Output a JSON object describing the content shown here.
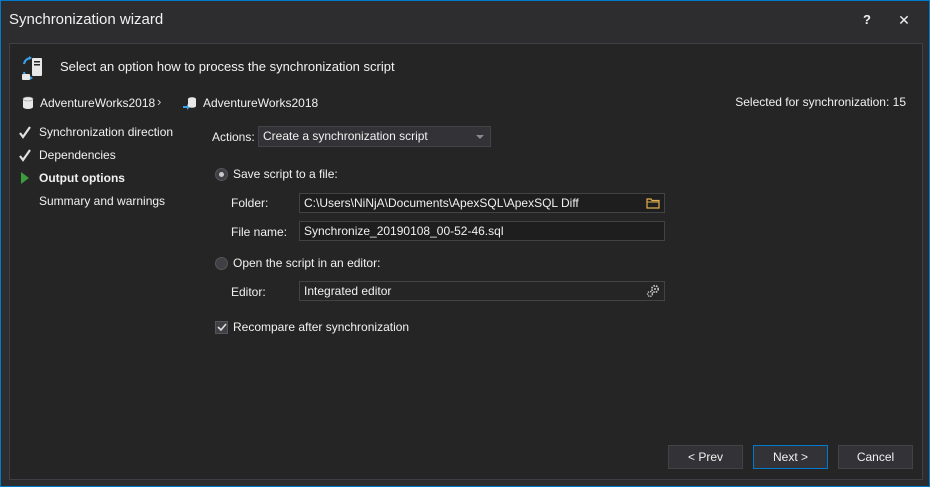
{
  "window": {
    "title": "Synchronization wizard",
    "help_label": "?",
    "close_label": "✕"
  },
  "header": {
    "text": "Select an option how to process the synchronization script"
  },
  "databases": {
    "source": "AdventureWorks2018",
    "target": "AdventureWorks2018",
    "separator": "›"
  },
  "selected": {
    "text": "Selected for synchronization: 15"
  },
  "nav": {
    "items": [
      {
        "label": "Synchronization direction",
        "state": "done"
      },
      {
        "label": "Dependencies",
        "state": "done"
      },
      {
        "label": "Output options",
        "state": "current"
      },
      {
        "label": "Summary and warnings",
        "state": "pending"
      }
    ]
  },
  "options": {
    "actions_label": "Actions:",
    "actions_value": "Create a synchronization script",
    "save_radio_label": "Save script to a file:",
    "folder_label": "Folder:",
    "folder_value": "C:\\Users\\NiNjA\\Documents\\ApexSQL\\ApexSQL Diff",
    "filename_label": "File name:",
    "filename_value": "Synchronize_20190108_00-52-46.sql",
    "open_radio_label": "Open the script in an editor:",
    "editor_label": "Editor:",
    "editor_value": "Integrated editor",
    "recompare_label": "Recompare after synchronization"
  },
  "buttons": {
    "prev": "< Prev",
    "next": "Next >",
    "cancel": "Cancel"
  },
  "colors": {
    "accent": "#007acc",
    "check": "#e0e0e0",
    "current_arrow": "#3c9b3c"
  }
}
